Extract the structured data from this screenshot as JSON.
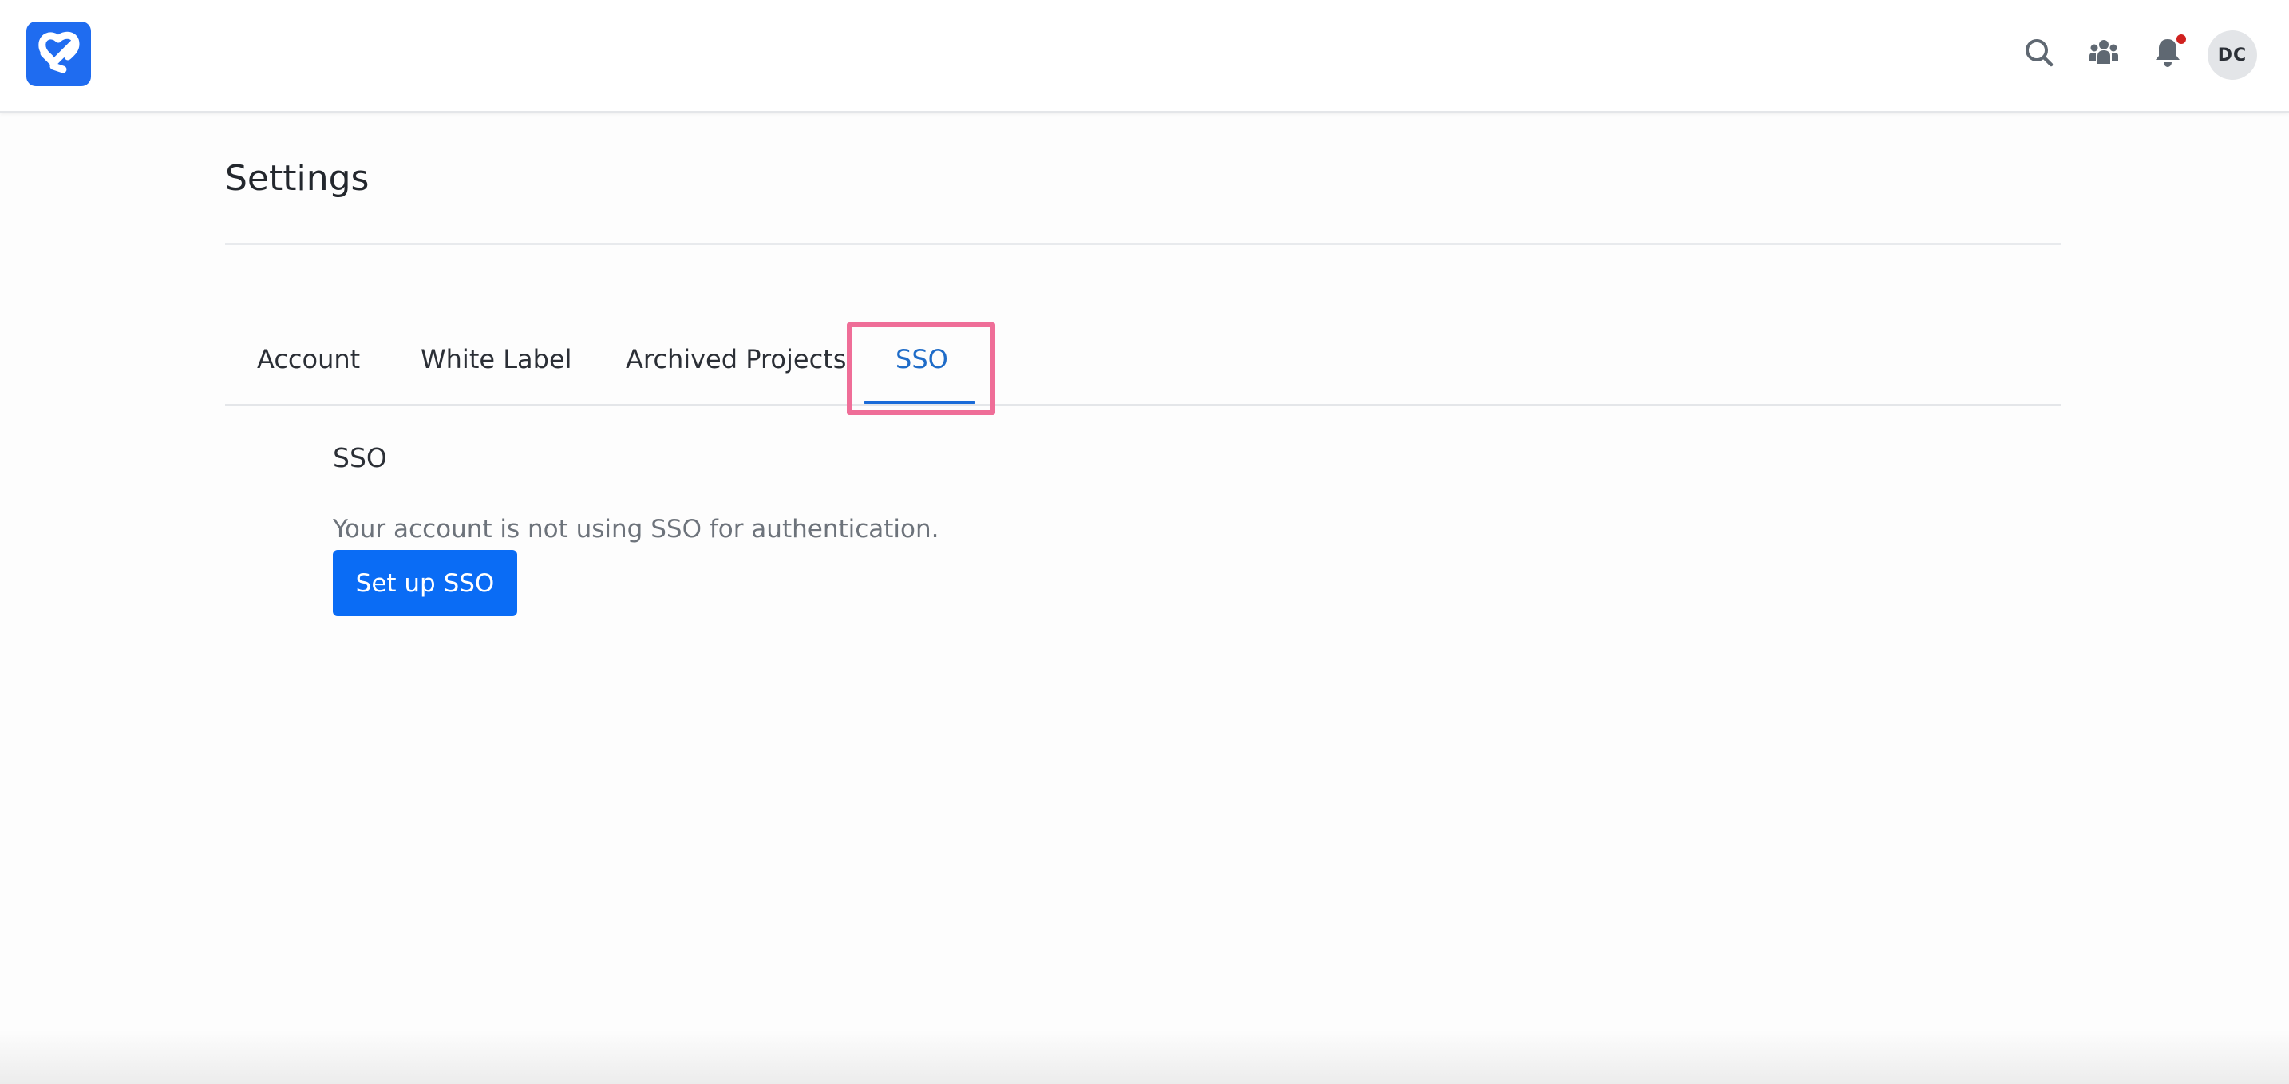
{
  "header": {
    "logo_icon": "heart-link-logo-icon",
    "icons": [
      "search-icon",
      "team-icon",
      "bell-icon"
    ],
    "avatar_initials": "DC",
    "accent_color": "#1f6cf0",
    "notification_dot_color": "#d0211f"
  },
  "page": {
    "title": "Settings"
  },
  "tabs": [
    {
      "label": "Account",
      "active": false
    },
    {
      "label": "White Label",
      "active": false
    },
    {
      "label": "Archived Projects",
      "active": false
    },
    {
      "label": "SSO",
      "active": true
    }
  ],
  "sso": {
    "title": "SSO",
    "description": "Your account is not using SSO for authentication.",
    "button_label": "Set up SSO",
    "button_color": "#0a6cf5"
  },
  "annotation": {
    "highlight_color": "#ef6e98"
  }
}
